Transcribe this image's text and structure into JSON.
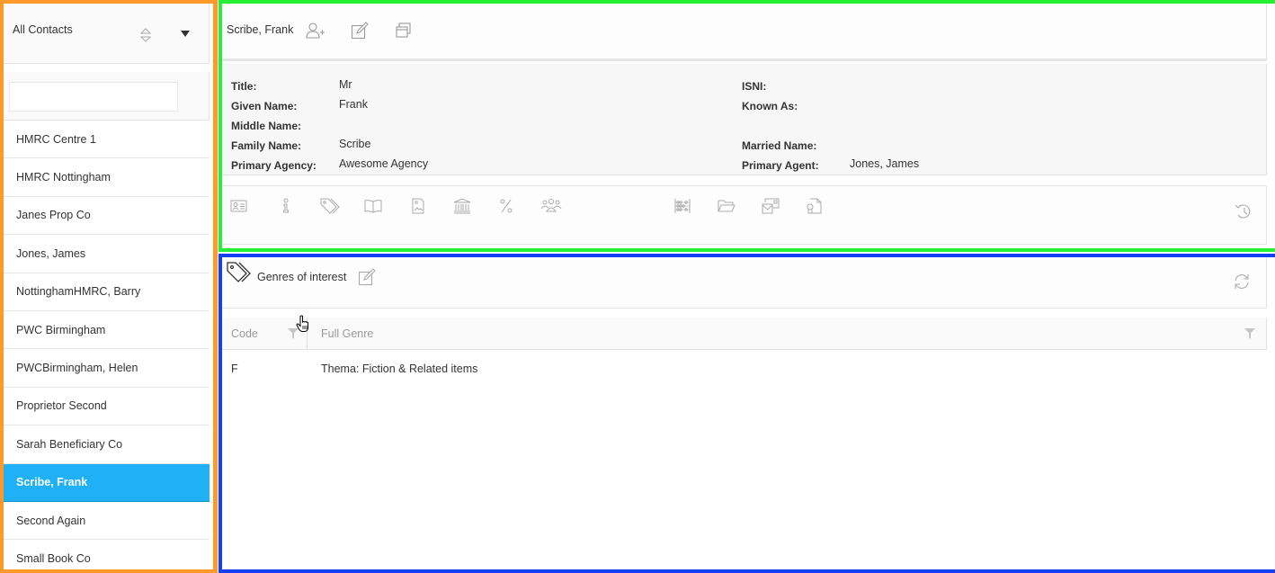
{
  "sidebar": {
    "title": "All Contacts",
    "search": {
      "value": "",
      "placeholder": ""
    },
    "items": [
      {
        "label": "HMRC Centre 1",
        "active": false
      },
      {
        "label": "HMRC Nottingham",
        "active": false
      },
      {
        "label": "Janes Prop Co",
        "active": false
      },
      {
        "label": "Jones, James",
        "active": false
      },
      {
        "label": "NottinghamHMRC, Barry",
        "active": false
      },
      {
        "label": "PWC Birmingham",
        "active": false
      },
      {
        "label": "PWCBirmingham, Helen",
        "active": false
      },
      {
        "label": "Proprietor Second",
        "active": false
      },
      {
        "label": "Sarah Beneficiary Co",
        "active": false
      },
      {
        "label": "Scribe, Frank",
        "active": true
      },
      {
        "label": "Second Again",
        "active": false
      },
      {
        "label": "Small Book Co",
        "active": false
      }
    ]
  },
  "contact": {
    "name": "Scribe, Frank",
    "header_icons": [
      "add-user-icon",
      "edit-icon",
      "duplicate-icon"
    ],
    "fields_left": [
      {
        "label": "Title:",
        "value": "Mr"
      },
      {
        "label": "Given Name:",
        "value": "Frank"
      },
      {
        "label": "Middle Name:",
        "value": ""
      },
      {
        "label": "Family Name:",
        "value": "Scribe"
      },
      {
        "label": "Primary Agency:",
        "value": "Awesome Agency"
      }
    ],
    "fields_right": [
      {
        "label": "ISNI:",
        "value": ""
      },
      {
        "label": "Known As:",
        "value": ""
      },
      {
        "label": "Married Name:",
        "value": ""
      },
      {
        "label": "Primary Agent:",
        "value": "Jones, James"
      }
    ],
    "toolbar_icons": [
      "id-card-icon",
      "info-icon",
      "tags-icon",
      "book-icon",
      "image-file-icon",
      "bank-icon",
      "percent-icon",
      "group-icon",
      "abacus-icon",
      "folder-open-icon",
      "mail-stamp-icon",
      "certificate-file-icon",
      "history-icon"
    ]
  },
  "genres": {
    "title": "Genres of interest",
    "columns": {
      "code": "Code",
      "full_genre": "Full Genre"
    },
    "rows": [
      {
        "code": "F",
        "full_genre": "Thema: Fiction & Related items"
      }
    ]
  },
  "colors": {
    "accent": "#1fb0f6",
    "frame_left": "#ff9a2a",
    "frame_top": "#27ef35",
    "frame_bottom": "#1340f5"
  }
}
